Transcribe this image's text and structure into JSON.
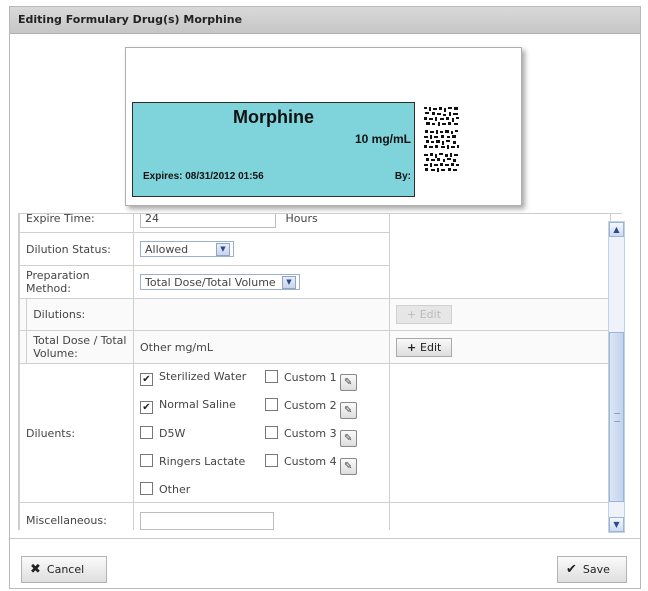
{
  "title": "Editing Formulary Drug(s) Morphine",
  "label": {
    "drug_name": "Morphine",
    "concentration": "10 mg/mL",
    "expires_text": "Expires:  08/31/2012 01:56",
    "by_text": "By:",
    "background_color": "#7fd4dc"
  },
  "form": {
    "expire_time": {
      "label": "Expire Time:",
      "value": "24",
      "unit": "Hours"
    },
    "dilution_status": {
      "label": "Dilution Status:",
      "selected": "Allowed"
    },
    "preparation_method": {
      "label": "Preparation Method:",
      "selected": "Total Dose/Total Volume"
    },
    "dilutions": {
      "label": "Dilutions:",
      "value": "",
      "edit_label": "Edit",
      "edit_enabled": false
    },
    "total_dose": {
      "label": "Total Dose / Total Volume:",
      "value": "Other mg/mL",
      "edit_label": "Edit",
      "edit_enabled": true
    },
    "diluents": {
      "label": "Diluents:",
      "options": [
        {
          "label": "Sterilized Water",
          "checked": true
        },
        {
          "label": "Custom 1",
          "checked": false
        },
        {
          "label": "Normal Saline",
          "checked": true
        },
        {
          "label": "Custom 2",
          "checked": false
        },
        {
          "label": "D5W",
          "checked": false
        },
        {
          "label": "Custom 3",
          "checked": false
        },
        {
          "label": "Ringers Lactate",
          "checked": false
        },
        {
          "label": "Custom 4",
          "checked": false
        },
        {
          "label": "Other",
          "checked": false
        }
      ]
    },
    "miscellaneous": {
      "label": "Miscellaneous:",
      "value": ""
    }
  },
  "footer": {
    "cancel_label": "Cancel",
    "save_label": "Save"
  },
  "icons": {
    "cancel": "x-icon",
    "save": "checkmark-icon",
    "edit": "plus-icon",
    "custom": "pencil-icon",
    "select": "chevron-down-icon"
  }
}
